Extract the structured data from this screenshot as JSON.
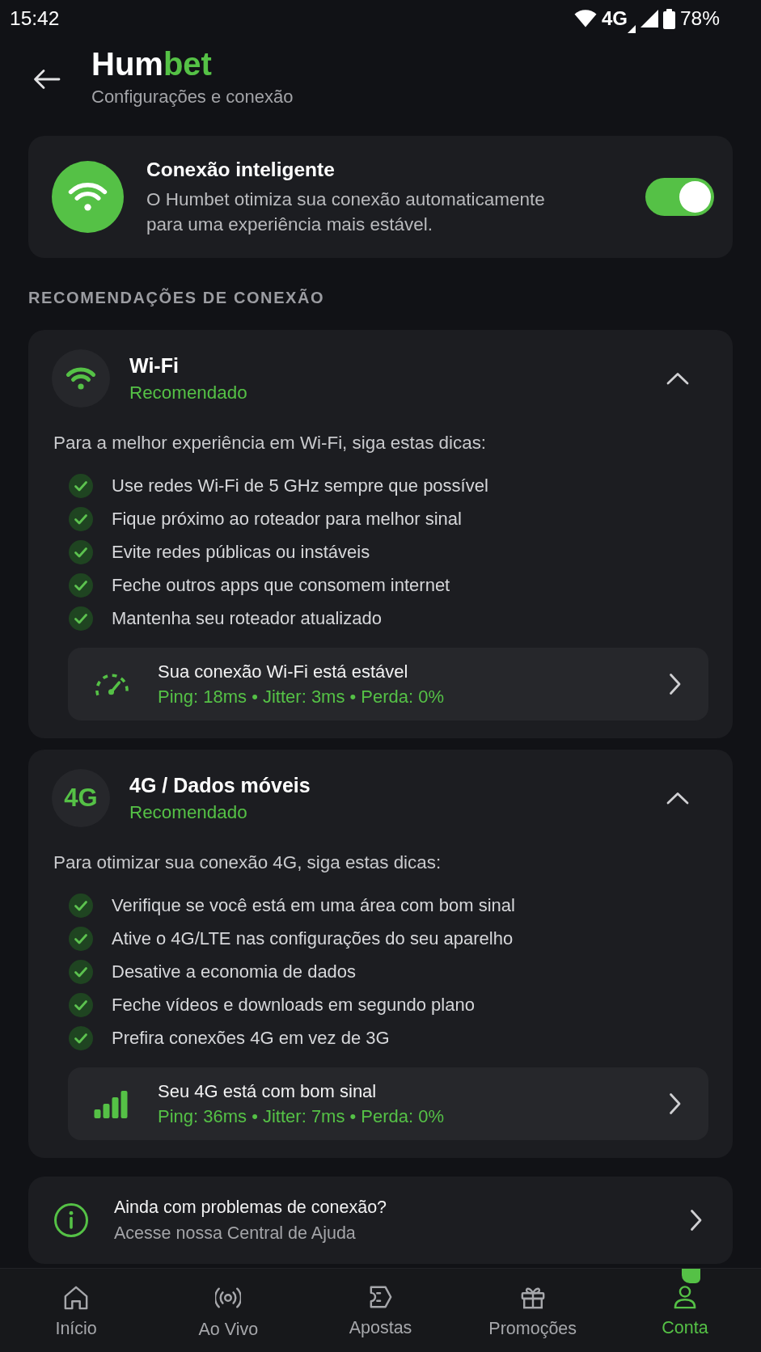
{
  "status_bar": {
    "time": "15:42",
    "network": "4G",
    "battery": "78%"
  },
  "header": {
    "brand": [
      {
        "text": "Hum",
        "accent": false
      },
      {
        "text": "bet",
        "accent": true
      }
    ],
    "subtitle": "Configurações e conexão"
  },
  "smart_connection": {
    "title": "Conexão inteligente",
    "description": "O Humbet otimiza sua conexão automaticamente para uma experiência mais estável.",
    "on": true
  },
  "section_title": "RECOMENDAÇÕES DE CONEXÃO",
  "connections": [
    {
      "kind": "wifi",
      "title": "Wi-Fi",
      "tag": "Recomendado",
      "expanded": true,
      "intro": "Para a melhor experiência em Wi-Fi, siga estas dicas:",
      "tips": [
        "Use redes Wi-Fi de 5 GHz sempre que possível",
        "Fique próximo ao roteador para melhor sinal",
        "Evite redes públicas ou instáveis",
        "Feche outros apps que consomem internet",
        "Mantenha seu roteador atualizado"
      ],
      "status": {
        "kind": "gauge",
        "title": "Sua conexão Wi-Fi está estável",
        "stats": "Ping: 18ms • Jitter: 3ms • Perda: 0%"
      }
    },
    {
      "kind": "cellular",
      "icon_text": "4G",
      "title": "4G / Dados móveis",
      "tag": "Recomendado",
      "expanded": true,
      "intro": "Para otimizar sua conexão 4G, siga estas dicas:",
      "tips": [
        "Verifique se você está em uma área com bom sinal",
        "Ative o 4G/LTE nas configurações do seu aparelho",
        "Desative a economia de dados",
        "Feche vídeos e downloads em segundo plano",
        "Prefira conexões 4G em vez de 3G"
      ],
      "status": {
        "kind": "bars",
        "title": "Seu 4G está com bom sinal",
        "stats": "Ping: 36ms • Jitter: 7ms • Perda: 0%"
      }
    }
  ],
  "help": {
    "title": "Ainda com problemas de conexão?",
    "subtitle": "Acesse nossa Central de Ajuda"
  },
  "nav": [
    {
      "kind": "home",
      "label": "Início",
      "selected": false,
      "badge": false
    },
    {
      "kind": "live",
      "label": "Ao Vivo",
      "selected": false,
      "badge": false
    },
    {
      "kind": "bets",
      "label": "Apostas",
      "selected": false,
      "badge": false
    },
    {
      "kind": "gifts",
      "label": "Promoções",
      "selected": false,
      "badge": false
    },
    {
      "kind": "account",
      "label": "Conta",
      "selected": true,
      "badge": true
    }
  ]
}
